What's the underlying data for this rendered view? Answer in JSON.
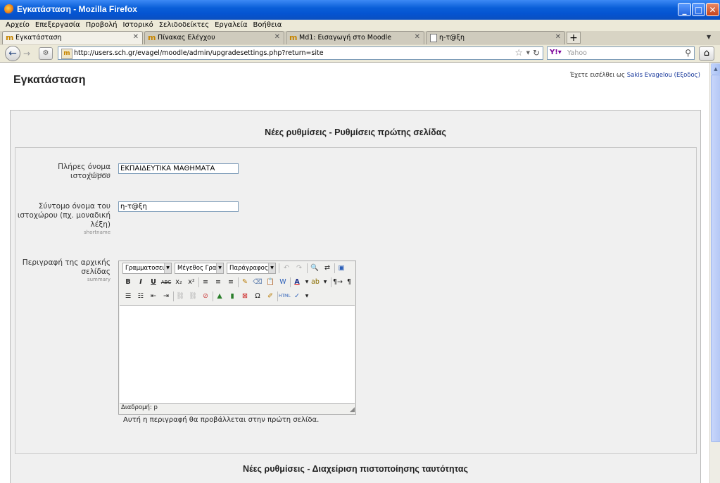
{
  "window": {
    "title": "Εγκατάσταση - Mozilla Firefox"
  },
  "menu": [
    "Αρχείο",
    "Επεξεργασία",
    "Προβολή",
    "Ιστορικό",
    "Σελιδοδείκτες",
    "Εργαλεία",
    "Βοήθεια"
  ],
  "tabs": [
    {
      "label": "Εγκατάσταση",
      "icon": "moodle-icon"
    },
    {
      "label": "Πίνακας Ελέγχου",
      "icon": "moodle-icon"
    },
    {
      "label": "Md1: Εισαγωγή στο Moodle",
      "icon": "moodle-icon"
    },
    {
      "label": "η-τ@ξη",
      "icon": "page-icon"
    }
  ],
  "nav": {
    "url": "http://users.sch.gr/evagel/moodle/admin/upgradesettings.php?return=site",
    "search_placeholder": "Yahoo"
  },
  "page": {
    "heading": "Εγκατάσταση",
    "login_prefix": "Έχετε εισέλθει ως",
    "login_user": "Sakis Evagelou",
    "logout": "(Εξοδος)"
  },
  "section1": {
    "title": "Νέες ρυθμίσεις - Ρυθμίσεις πρώτης σελίδας",
    "fullname": {
      "label": "Πλήρες όνομα ιστοχώρου",
      "sub": "fullname",
      "value": "ΕΚΠΑΙΔΕΥΤΙΚΑ ΜΑΘΗΜΑΤΑ"
    },
    "shortname": {
      "label_line1": "Σύντομο όνομα του",
      "label_line2": "ιστοχώρου (πχ. μοναδική",
      "label_line3": "λέξη)",
      "sub": "shortname",
      "value": "η-τ@ξη"
    },
    "summary": {
      "label_line1": "Περιγραφή της αρχικής",
      "label_line2": "σελίδας",
      "sub": "summary",
      "font_family": "Γραμματοσειρά",
      "font_size": "Μέγεθος Γραμ",
      "format": "Παράγραφος",
      "path": "Διαδρομή: p",
      "help": "Αυτή η περιγραφή θα προβάλλεται στην πρώτη σελίδα."
    }
  },
  "section2": {
    "title": "Νέες ρυθμίσεις - Διαχείριση πιστοποίησης ταυτότητας"
  }
}
